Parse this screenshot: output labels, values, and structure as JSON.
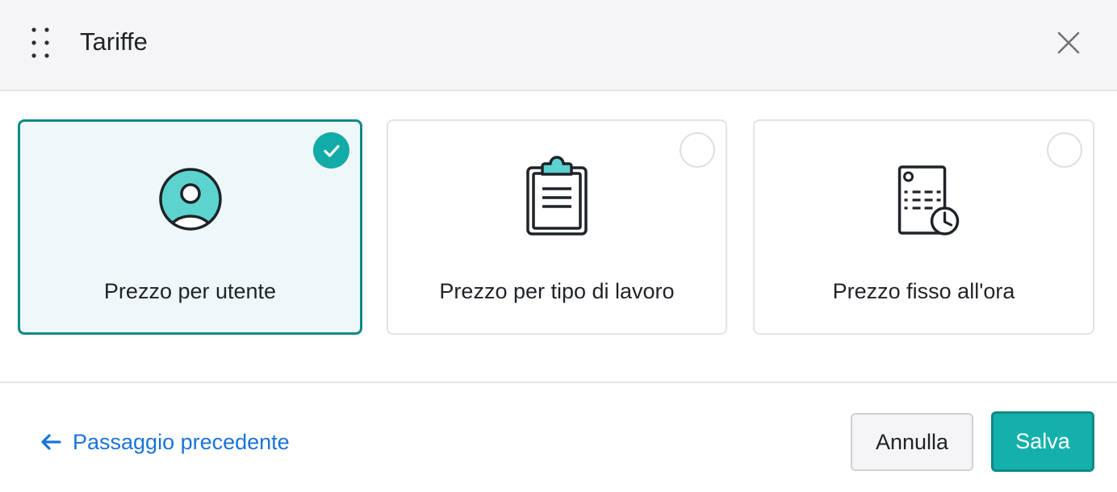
{
  "header": {
    "title": "Tariffe",
    "drag_icon": "drag-handle-icon",
    "close_icon": "close-icon"
  },
  "options": [
    {
      "label": "Prezzo per utente",
      "icon": "user-avatar-icon",
      "selected": true
    },
    {
      "label": "Prezzo per tipo di lavoro",
      "icon": "clipboard-icon",
      "selected": false
    },
    {
      "label": "Prezzo fisso all'ora",
      "icon": "document-clock-icon",
      "selected": false
    }
  ],
  "footer": {
    "back_label": "Passaggio precedente",
    "cancel_label": "Annulla",
    "save_label": "Salva"
  },
  "colors": {
    "accent": "#13aba7",
    "accent_border": "#0e8a87",
    "selected_bg": "#eff8f9",
    "link": "#1a73d9",
    "icon_fill": "#5cd3cf"
  }
}
